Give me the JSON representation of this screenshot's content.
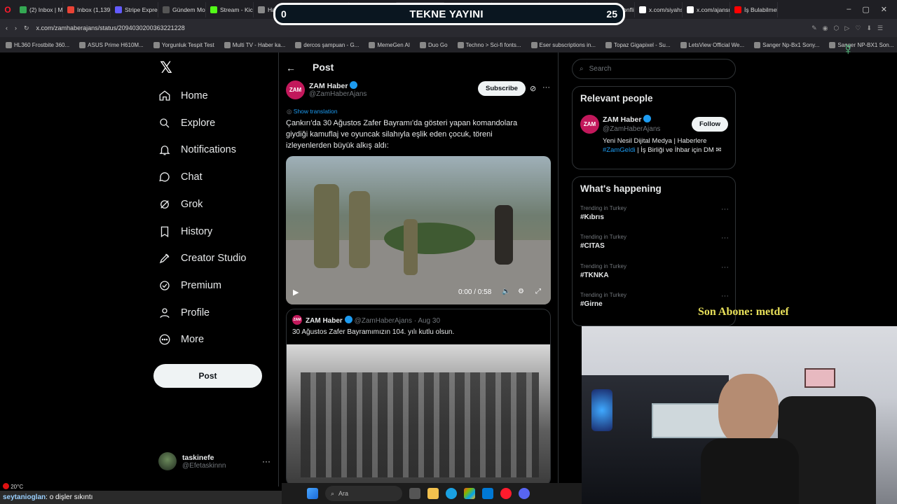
{
  "overlay": {
    "left_score": "0",
    "title": "TEKNE YAYINI",
    "right_score": "25",
    "last_sub": "Son Abone: metdef"
  },
  "browser": {
    "tabs": [
      {
        "label": "(2) Inbox | Ma",
        "color": "#34a853"
      },
      {
        "label": "Inbox (1,139)",
        "color": "#ea4335"
      },
      {
        "label": "Stripe Express",
        "color": "#635bff"
      },
      {
        "label": "Gündem Motor",
        "color": "#555555"
      },
      {
        "label": "Stream - Kick",
        "color": "#53fc18"
      },
      {
        "label": "Haber Akışı",
        "color": "#888888"
      },
      {
        "label": "",
        "color": "#e5a50a"
      },
      {
        "label": "KickLink — Ct",
        "color": "#53fc18"
      },
      {
        "label": "ZAM Haber on X: \"Çan",
        "color": "#ffffff"
      },
      {
        "label": "x.com/Albayin",
        "color": "#ffffff"
      },
      {
        "label": "x.com/loyasha",
        "color": "#ffffff"
      },
      {
        "label": "x.com/sonkalt",
        "color": "#ffffff"
      },
      {
        "label": "x.com/Conflict",
        "color": "#ffffff"
      },
      {
        "label": "x.com/siyahsa",
        "color": "#ffffff"
      },
      {
        "label": "x.com/ajansm",
        "color": "#ffffff"
      },
      {
        "label": "İş Bulabilmek",
        "color": "#ff0000"
      }
    ],
    "url": "x.com/zamhaberajans/status/2094030200363221228",
    "bookmarks": [
      "HL360 Frostbite 360...",
      "ASUS Prime H610M...",
      "Yorgunluk Tespit Test",
      "Multi TV - Haber ka...",
      "dercos şampuan - G...",
      "MemeGen AI",
      "Duo Go",
      "Techno > Sci-fi fonts...",
      "Eser subscriptions in...",
      "Topaz Gigapixel - Su...",
      "LetsView Official We...",
      "Sanger Np-Bx1 Sony...",
      "Sanger NP-BX1 Son..."
    ]
  },
  "nav": {
    "items": [
      "Home",
      "Explore",
      "Notifications",
      "Chat",
      "Grok",
      "History",
      "Creator Studio",
      "Premium",
      "Profile",
      "More"
    ],
    "post_button": "Post",
    "account": {
      "name": "taskinefe",
      "handle": "@Efetaskinnn"
    }
  },
  "post": {
    "header": "Post",
    "author": "ZAM Haber",
    "handle": "@ZamHaberAjans",
    "avatar_text": "ZAM",
    "subscribe": "Subscribe",
    "show_translation": "Show translation",
    "text": "Çankırı'da 30 Ağustos Zafer Bayramı'da gösteri yapan komandolara giydiği kamuflaj ve oyuncak silahıyla eşlik eden çocuk, töreni izleyenlerden büyük alkış aldı:",
    "video_time": "0:00 / 0:58",
    "quoted": {
      "author": "ZAM Haber",
      "handle": "@ZamHaberAjans",
      "date": "· Aug 30",
      "text": "30 Ağustos Zafer Bayramımızın 104. yılı kutlu olsun."
    }
  },
  "right": {
    "search_placeholder": "Search",
    "relevant_title": "Relevant people",
    "person": {
      "name": "ZAM Haber",
      "handle": "@ZamHaberAjans",
      "follow": "Follow",
      "bio_a": "Yeni Nesil Dijital Medya | Haberlere ",
      "bio_tag": "#ZamGeldi",
      "bio_b": " | İş Birliği ve İhbar için DM"
    },
    "happening_title": "What's happening",
    "trends": [
      {
        "context": "Trending in Turkey",
        "tag": "#Kıbrıs"
      },
      {
        "context": "Trending in Turkey",
        "tag": "#CITAS"
      },
      {
        "context": "Trending in Turkey",
        "tag": "#TKNKA"
      },
      {
        "context": "Trending in Turkey",
        "tag": "#Girne"
      }
    ]
  },
  "stream_chat": {
    "user": "seytanioglan",
    "message": ": o dişler sıkıntı"
  },
  "taskbar": {
    "search": "Ara",
    "weather": "20°C"
  }
}
